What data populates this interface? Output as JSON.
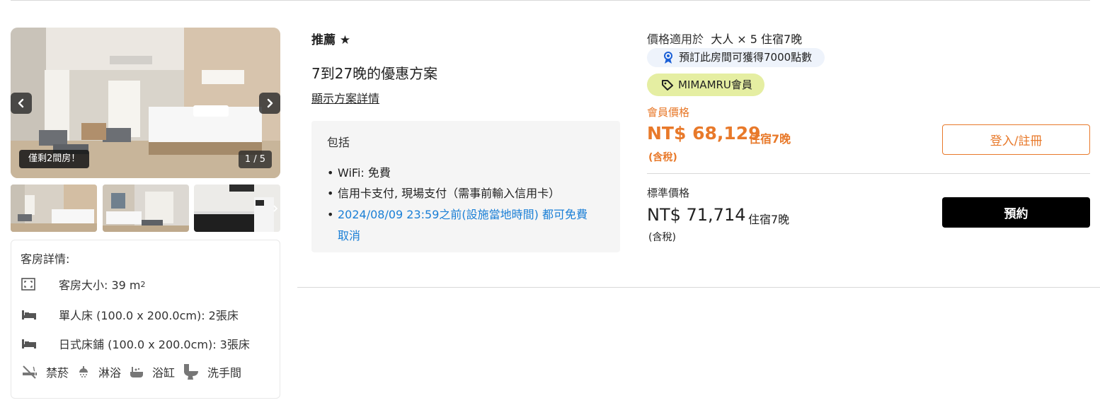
{
  "gallery": {
    "availability_badge": "僅剩2間房！",
    "counter": "1 / 5",
    "prev_icon": "chevron-left-icon",
    "next_icon": "chevron-right-icon"
  },
  "room_details": {
    "title": "客房詳情:",
    "size_label": "客房大小: 39 m",
    "size_sup": "2",
    "single_bed": "單人床 (100.0 x 200.0cm): 2張床",
    "futon": "日式床鋪 (100.0 x 200.0cm): 3張床",
    "amenities": [
      {
        "icon": "no-smoking-icon",
        "label": "禁菸"
      },
      {
        "icon": "shower-icon",
        "label": "淋浴"
      },
      {
        "icon": "bathtub-icon",
        "label": "浴缸"
      },
      {
        "icon": "toilet-icon",
        "label": "洗手間"
      }
    ]
  },
  "plan": {
    "badge": "推薦 ★",
    "name": "7到27晚的優惠方案",
    "details_link": "顯示方案詳情",
    "includes_title": "包括",
    "includes": [
      "WiFi: 免費",
      "信用卡支付, 現場支付（需事前輸入信用卡）",
      "2024/08/09 23:59之前(設施當地時間) 都可免費",
      "取消"
    ]
  },
  "pricing": {
    "price_for_label": "價格適用於",
    "price_for_value": "大人 × 5 住宿7晚",
    "points_text": "預訂此房間可獲得7000點數",
    "member_tag": "MIMAMRU會員",
    "member_label": "會員價格",
    "member_price": "NT$ 68,129",
    "member_nights": "住宿7晚",
    "member_tax": "(含稅)",
    "login_button": "登入/註冊",
    "standard_label": "標準價格",
    "standard_price": "NT$ 71,714",
    "standard_nights": "住宿7晚",
    "standard_tax": "(含稅)",
    "book_button": "預約"
  },
  "colors": {
    "accent_orange": "#e8792a",
    "link_blue": "#1a7fd6",
    "member_tag_bg": "#e5eea2",
    "points_bg": "#eef3fb"
  }
}
